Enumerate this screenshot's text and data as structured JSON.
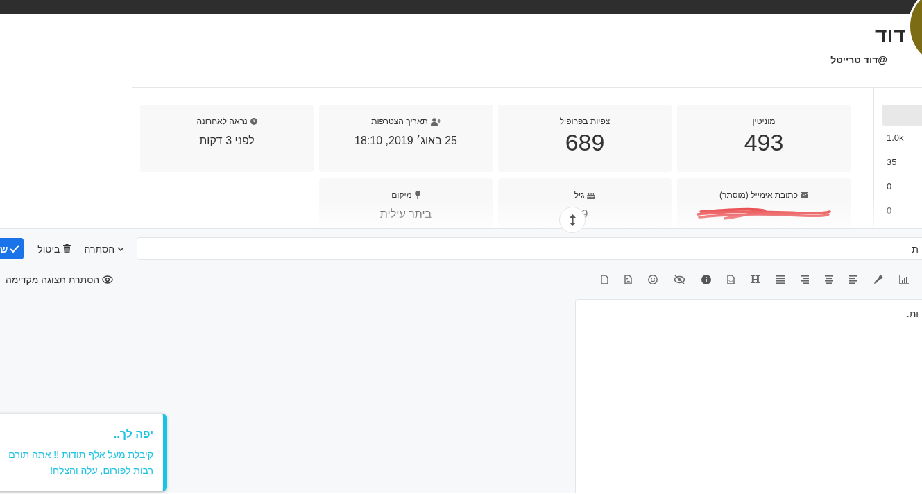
{
  "profile": {
    "name": "דוד",
    "handle": "@דוד טרייטל"
  },
  "stats": [
    {
      "label": "מוניטין",
      "value": "493",
      "kind": "count"
    },
    {
      "label": "צפיות בפרופיל",
      "value": "689",
      "kind": "count"
    },
    {
      "label": "תאריך הצטרפות",
      "value": "25 באוג׳ 2019, 18:10",
      "kind": "text"
    },
    {
      "label": "נראה לאחרונה",
      "value": "לפני 3 דקות",
      "kind": "text"
    },
    {
      "label": "כתובת אימייל (מוסתר)",
      "kind": "redacted"
    },
    {
      "label": "גיל",
      "value": "9",
      "kind": "text"
    },
    {
      "label": "מיקום",
      "value": "ביתר עילית",
      "kind": "text"
    }
  ],
  "side_counts": [
    "1.0k",
    "35",
    "0",
    "0"
  ],
  "composer": {
    "title_field": {
      "value": "ת"
    },
    "buttons": [
      {
        "label": "הסתרה",
        "kind": "dropdown"
      },
      {
        "label": "ביטול",
        "kind": "cancel"
      },
      {
        "label": "ש",
        "kind": "submit"
      }
    ],
    "preview_toggle": "הסתרת תצוגה מקדימה",
    "heading_button": "H",
    "editor_text": "ות."
  },
  "toast": {
    "title": "יפה לך..",
    "message": "קיבלת מעל אלף תודות !! אתה תורם רבות לפורום, עלה והצלח!"
  }
}
